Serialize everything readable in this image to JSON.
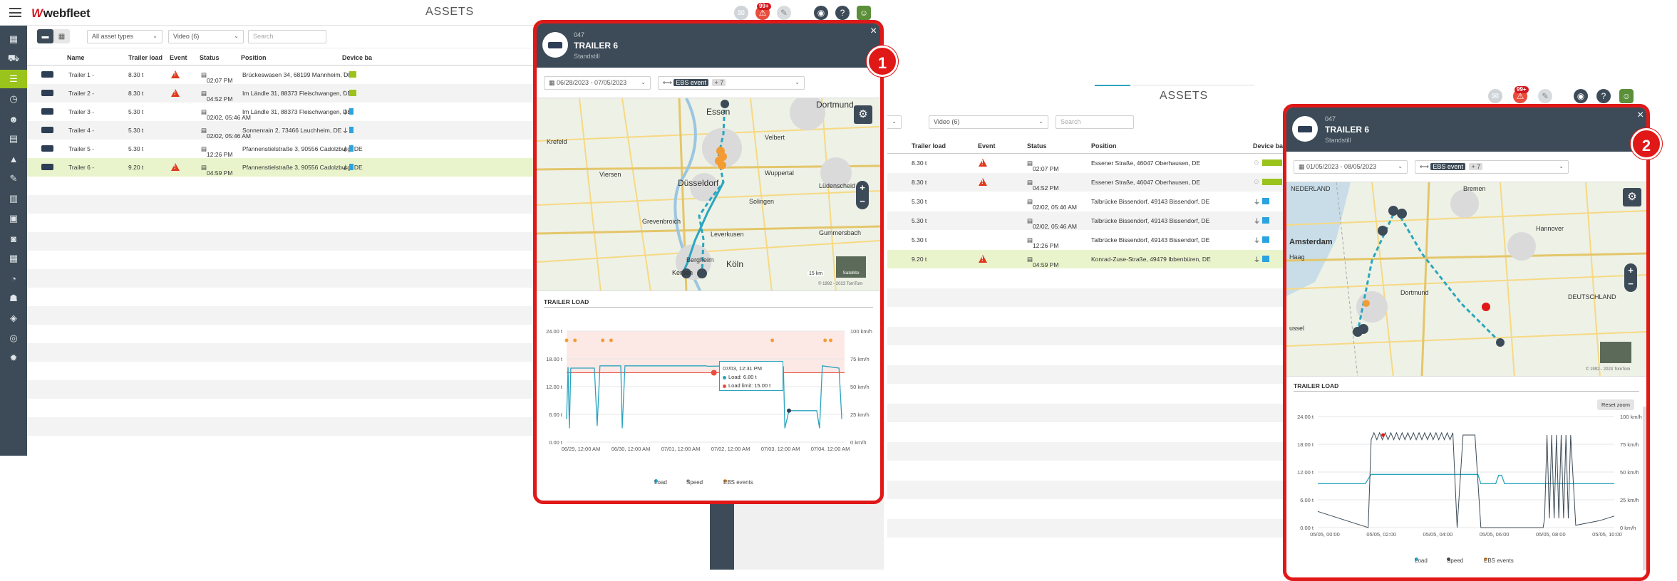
{
  "app": {
    "brand": "webfleet",
    "title": "ASSETS",
    "notification_badge": "99+"
  },
  "toolbar": {
    "asset_type": "All asset types",
    "view": "Video (6)",
    "search_placeholder": "Search"
  },
  "columns": {
    "name": "Name",
    "trailer_load": "Trailer load",
    "event": "Event",
    "status": "Status",
    "position": "Position",
    "device": "Device ba"
  },
  "rows_left": [
    {
      "name": "Trailer 1 -",
      "load": "8.30 t",
      "warn": true,
      "status": "02:07 PM",
      "position": "Brückeswasen 34, 68199  Mannheim, DE",
      "plug": false
    },
    {
      "name": "Trailer 2 -",
      "load": "8.30 t",
      "warn": true,
      "status": "04:52 PM",
      "position": "Im Ländle 31, 88373  Fleischwangen, DE",
      "plug": false
    },
    {
      "name": "Trailer 3 -",
      "load": "5.30 t",
      "warn": false,
      "status": "02/02, 05:46 AM",
      "position": "Im Ländle 31, 88373  Fleischwangen, DE",
      "plug": true
    },
    {
      "name": "Trailer 4 -",
      "load": "5.30 t",
      "warn": false,
      "status": "02/02, 05:46 AM",
      "position": "Sonnenrain 2, 73466  Lauchheim, DE",
      "plug": true
    },
    {
      "name": "Trailer 5 -",
      "load": "5.30 t",
      "warn": false,
      "status": "12:26 PM",
      "position": "Pfannenstielstraße 3, 90556  Cadolzburg, DE",
      "plug": true
    },
    {
      "name": "Trailer 6 -",
      "load": "9.20 t",
      "warn": true,
      "status": "04:59 PM",
      "position": "Pfannenstielstraße 3, 90556  Cadolzburg, DE",
      "plug": true
    }
  ],
  "rows_right": [
    {
      "load": "8.30 t",
      "warn": true,
      "status": "02:07 PM",
      "position": "Essener Straße, 46047 Oberhausen, DE",
      "plug": false
    },
    {
      "load": "8.30 t",
      "warn": true,
      "status": "04:52 PM",
      "position": "Essener Straße, 46047 Oberhausen, DE",
      "plug": false
    },
    {
      "load": "5.30 t",
      "warn": false,
      "status": "02/02, 05:46 AM",
      "position": "Talbrücke Bissendorf, 49143 Bissendorf, DE",
      "plug": true
    },
    {
      "load": "5.30 t",
      "warn": false,
      "status": "02/02, 05:46 AM",
      "position": "Talbrücke Bissendorf, 49143 Bissendorf, DE",
      "plug": true
    },
    {
      "load": "5.30 t",
      "warn": false,
      "status": "12:26 PM",
      "position": "Talbrücke Bissendorf, 49143 Bissendorf, DE",
      "plug": true
    },
    {
      "load": "9.20 t",
      "warn": true,
      "status": "04:59 PM",
      "position": "Konrad-Zuse-Straße, 49479 Ibbenbüren, DE",
      "plug": true
    }
  ],
  "popup1": {
    "id": "047",
    "name": "TRAILER 6",
    "state": "Standstill",
    "date_range": "06/28/2023 - 07/05/2023",
    "filter_tag": "EBS event",
    "filter_more": "+ 7",
    "map_cities": [
      "Essen",
      "Dortmund",
      "Krefeld",
      "Velbert",
      "Viersen",
      "Wuppertal",
      "Düsseldorf",
      "Lüdenscheid",
      "Solingen",
      "Grevenbroich",
      "Leverkusen",
      "Gummersbach",
      "Bergheim",
      "Köln",
      "Kerpen"
    ],
    "map_scale": "15 km",
    "map_sat": "Satellite",
    "map_copy": "© 1992 - 2023 TomTom",
    "chart_title": "TRAILER LOAD",
    "tooltip": {
      "time": "07/03, 12:31 PM",
      "load": "Load: 6.80 t",
      "limit": "Load limit: 15.00 t"
    },
    "badge_number": "1"
  },
  "popup2": {
    "id": "047",
    "name": "TRAILER 6",
    "state": "Standstill",
    "date_range": "01/05/2023 - 08/05/2023",
    "filter_tag": "EBS event",
    "filter_more": "+ 7",
    "map_cities": [
      "NEDERLAND",
      "Bremen",
      "Amsterdam",
      "Hannover",
      "DEUTSCHLAND",
      "Haag",
      "ussel",
      "Dortmund"
    ],
    "map_copy": "© 1992 - 2023 TomTom",
    "chart_title": "TRAILER LOAD",
    "reset_zoom": "Reset zoom",
    "badge_number": "2"
  },
  "chart_data": [
    {
      "type": "line",
      "title": "TRAILER LOAD",
      "x": [
        "06/29, 12:00 AM",
        "06/30, 12:00 AM",
        "07/01, 12:00 AM",
        "07/02, 12:00 AM",
        "07/03, 12:00 AM",
        "07/04, 12:00 AM"
      ],
      "y_left_ticks": [
        "0.00 t",
        "6.00 t",
        "12.00 t",
        "18.00 t",
        "24.00 t"
      ],
      "y_right_ticks": [
        "0 km/h",
        "25 km/h",
        "50 km/h",
        "75 km/h",
        "100 km/h"
      ],
      "ylim": [
        0,
        24
      ],
      "load_limit": 15.0,
      "series": [
        {
          "name": "Load",
          "color": "#2ba3bf"
        },
        {
          "name": "Speed",
          "color": "#bbbbbb"
        },
        {
          "name": "EBS events",
          "color": "#f39c34"
        }
      ]
    },
    {
      "type": "line",
      "title": "TRAILER LOAD",
      "x": [
        "05/05, 00:00",
        "05/05, 02:00",
        "05/05, 04:00",
        "05/05, 06:00",
        "05/05, 08:00",
        "05/05, 10:00"
      ],
      "y_left_ticks": [
        "0.00 t",
        "6.00 t",
        "12.00 t",
        "18.00 t",
        "24.00 t"
      ],
      "y_right_ticks": [
        "0 km/h",
        "25 km/h",
        "50 km/h",
        "75 km/h",
        "100 km/h"
      ],
      "ylim": [
        0,
        24
      ],
      "series": [
        {
          "name": "Load",
          "color": "#2ba3bf"
        },
        {
          "name": "Speed",
          "color": "#3c4b57"
        },
        {
          "name": "EBS events",
          "color": "#f39c34"
        }
      ]
    }
  ]
}
